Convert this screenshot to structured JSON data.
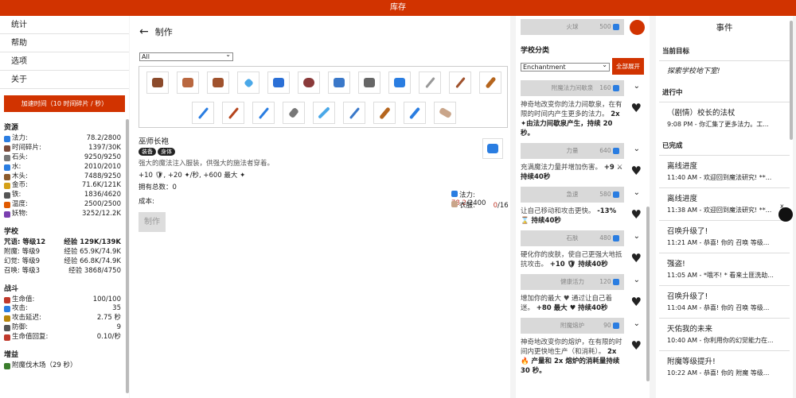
{
  "app": {
    "title": "库存"
  },
  "nav": [
    {
      "label": "统计"
    },
    {
      "label": "帮助"
    },
    {
      "label": "选项"
    },
    {
      "label": "关于"
    }
  ],
  "accel_button": "加速时间（10 时间碎片 / 秒）",
  "resources": {
    "title": "资源",
    "items": [
      {
        "name": "法力:",
        "value": "78.2/2800",
        "icon": "mana-icon",
        "color": "#2a7de1"
      },
      {
        "name": "时间碎片:",
        "value": "1397/30K",
        "icon": "time-shard-icon",
        "color": "#7a4a3a"
      },
      {
        "name": "石头:",
        "value": "9250/9250",
        "icon": "stone-icon",
        "color": "#777"
      },
      {
        "name": "水:",
        "value": "2010/2010",
        "icon": "water-icon",
        "color": "#2a7de1"
      },
      {
        "name": "木头:",
        "value": "7488/9250",
        "icon": "wood-icon",
        "color": "#8b5a2b"
      },
      {
        "name": "金币:",
        "value": "71.6K/121K",
        "icon": "gold-icon",
        "color": "#d4a017"
      },
      {
        "name": "铁:",
        "value": "1836/4620",
        "icon": "iron-icon",
        "color": "#555"
      },
      {
        "name": "温度:",
        "value": "2500/2500",
        "icon": "temperature-icon",
        "color": "#e05a00"
      },
      {
        "name": "妖物:",
        "value": "3252/12.2K",
        "icon": "creature-icon",
        "color": "#7a3fb0"
      }
    ]
  },
  "school": {
    "title": "学校",
    "items": [
      {
        "name": "咒语: 等级12",
        "exp_label": "经验",
        "exp": "129K/139K",
        "bold": true
      },
      {
        "name": "附魔: 等级9",
        "exp_label": "经验",
        "exp": "65.9K/74.9K"
      },
      {
        "name": "幻觉: 等级9",
        "exp_label": "经验",
        "exp": "66.8K/74.9K"
      },
      {
        "name": "召唤: 等级3",
        "exp_label": "经验",
        "exp": "3868/4750"
      }
    ]
  },
  "combat": {
    "title": "战斗",
    "items": [
      {
        "name": "生命值:",
        "value": "100/100",
        "icon": "heart-icon",
        "color": "#c0392b"
      },
      {
        "name": "攻击:",
        "value": "35",
        "icon": "sword-icon",
        "color": "#2a7de1"
      },
      {
        "name": "攻击延迟:",
        "value": "2.75 秒",
        "icon": "hourglass-icon",
        "color": "#b8860b"
      },
      {
        "name": "防御:",
        "value": "9",
        "icon": "shield-icon",
        "color": "#555"
      },
      {
        "name": "生命值回复:",
        "value": "0.10/秒",
        "icon": "heart-regen-icon",
        "color": "#c0392b"
      }
    ]
  },
  "buffs": {
    "title": "增益",
    "items": [
      {
        "label": "附魔伐木场（29 秒）"
      }
    ]
  },
  "crafting": {
    "title": "制作",
    "filter": "All",
    "item": {
      "name": "巫师长袍",
      "tags": [
        "装备",
        "身体"
      ],
      "desc": "强大的魔法注入服装，供强大的施法者穿着。",
      "effect": "+10 🛡, +20 ✦/秒, +600 最大 ✦",
      "owned_label": "拥有总数：",
      "owned": "0"
    },
    "cost_label": "成本:",
    "costs": [
      {
        "name": "法力:",
        "have": "78.2",
        "need": "/2400"
      },
      {
        "name": "衣服:",
        "have": "0",
        "need": "/16"
      }
    ],
    "craft_button": "制作"
  },
  "skills": {
    "top": {
      "name": "火球",
      "cost": "500"
    },
    "category_title": "学校分类",
    "category_value": "Enchantment",
    "expand_button": "全部展开",
    "list": [
      {
        "name": "附魔法力间歇泉",
        "cost": "160",
        "desc": "神奇地改变你的法力间歇泉，在有限的时间内产生更多的法力。",
        "bold": "2x ✦由法力间歇泉产生，持续 20 秒。"
      },
      {
        "name": "力量",
        "cost": "640",
        "desc": "充满魔法力量并增加伤害。",
        "bold": "+9 ⚔ 持续40秒"
      },
      {
        "name": "急速",
        "cost": "580",
        "desc": "让自己移动和攻击更快。",
        "bold": "-13% ⌛ 持续40秒"
      },
      {
        "name": "石肤",
        "cost": "480",
        "desc": "硬化你的皮肤，使自己更强大地抵抗攻击。",
        "bold": "+10 🛡 持续40秒"
      },
      {
        "name": "健康活力",
        "cost": "120",
        "desc": "增加你的最大 ♥ 通过让自己着迷。",
        "bold": "+80 最大 ♥ 持续40秒"
      },
      {
        "name": "附魔熔炉",
        "cost": "90",
        "desc": "神奇地改变你的熔炉，在有限的时间内更快地生产（和消耗）。",
        "bold": "2x 🔥 产量和 2x 熔炉的消耗量持续 30 秒。"
      }
    ]
  },
  "events": {
    "title": "事件",
    "goal_title": "当前目标",
    "goal": "探索学校地下室!",
    "progress_title": "进行中",
    "progress": [
      {
        "title": "（剧情）校长的法杖",
        "sub": "9:08 PM - 你汇集了更多法力。工..."
      }
    ],
    "done_title": "已完成",
    "done": [
      {
        "title": "离线进度",
        "sub": "11:40 AM - 欢迎回到魔法研究! **..."
      },
      {
        "title": "离线进度",
        "sub": "11:38 AM - 欢迎回到魔法研究! **..."
      },
      {
        "title": "召唤升级了!",
        "sub": "11:21 AM - 恭喜! 你的 召唤 等级..."
      },
      {
        "title": "强盗!",
        "sub": "11:05 AM - *哦不! * 看来土匪洗劫..."
      },
      {
        "title": "召唤升级了!",
        "sub": "11:04 AM - 恭喜! 你的 召唤 等级..."
      },
      {
        "title": "天佑我的未来",
        "sub": "10:40 AM - 你利用你的幻觉能力在..."
      },
      {
        "title": "附魔等级提升!",
        "sub": "10:22 AM - 恭喜! 你的 附魔 等级..."
      }
    ]
  }
}
